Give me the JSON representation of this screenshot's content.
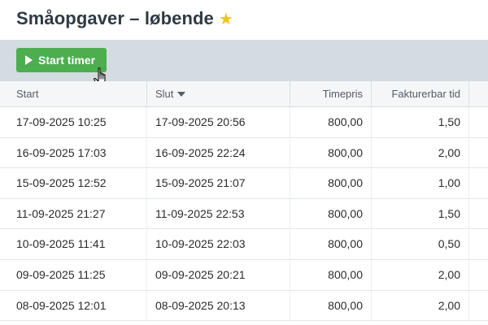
{
  "header": {
    "title": "Småopgaver – løbende",
    "star_icon": "star-icon"
  },
  "toolbar": {
    "start_label": "Start timer"
  },
  "table": {
    "columns": [
      {
        "label": "Start"
      },
      {
        "label": "Slut"
      },
      {
        "label": "Timepris"
      },
      {
        "label": "Fakturerbar tid"
      }
    ],
    "rows": [
      {
        "start": "17-09-2025 10:25",
        "end": "17-09-2025 20:56",
        "rate": "800,00",
        "billable": "1,50"
      },
      {
        "start": "16-09-2025 17:03",
        "end": "16-09-2025 22:24",
        "rate": "800,00",
        "billable": "2,00"
      },
      {
        "start": "15-09-2025 12:52",
        "end": "15-09-2025 21:07",
        "rate": "800,00",
        "billable": "1,00"
      },
      {
        "start": "11-09-2025 21:27",
        "end": "11-09-2025 22:53",
        "rate": "800,00",
        "billable": "1,50"
      },
      {
        "start": "10-09-2025 11:41",
        "end": "10-09-2025 22:03",
        "rate": "800,00",
        "billable": "0,50"
      },
      {
        "start": "09-09-2025 11:25",
        "end": "09-09-2025 20:21",
        "rate": "800,00",
        "billable": "2,00"
      },
      {
        "start": "08-09-2025 12:01",
        "end": "08-09-2025 20:13",
        "rate": "800,00",
        "billable": "2,00"
      }
    ]
  },
  "colors": {
    "accent_green": "#4cae4f",
    "toolbar_bg": "#d3dce1",
    "star": "#f5c518"
  }
}
